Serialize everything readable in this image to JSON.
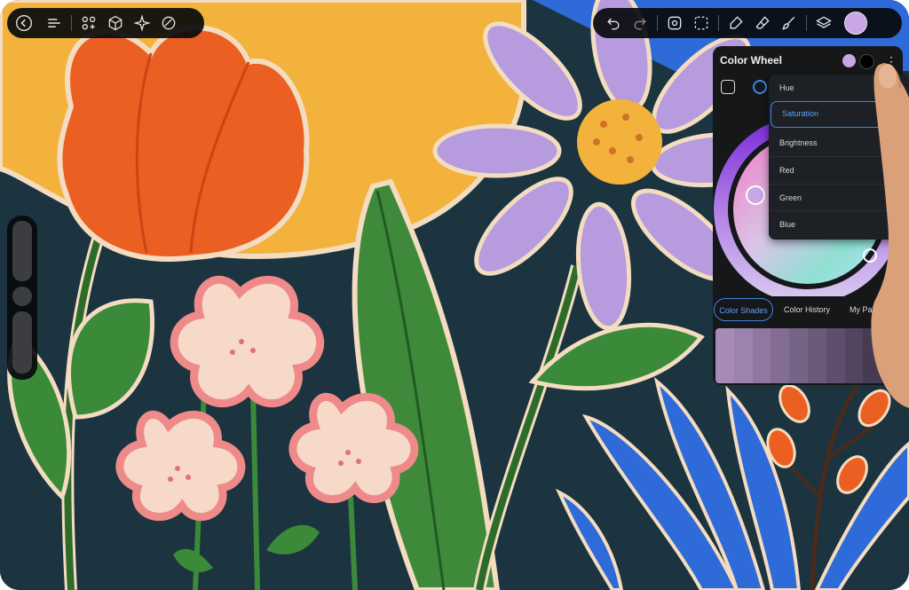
{
  "toolbar_left": {
    "back": "back-icon",
    "menu": "menu-icon",
    "actions": [
      "add-shape-icon",
      "cube-icon",
      "wand-icon",
      "eraser-shape-icon"
    ]
  },
  "toolbar_right": {
    "items": [
      "undo-icon",
      "redo-icon",
      "transform-icon",
      "selection-icon",
      "pen-icon",
      "eraser-icon",
      "brush-icon",
      "layers-icon"
    ],
    "current_color": "#c9a6e6"
  },
  "color_panel": {
    "title": "Color Wheel",
    "primary_color": "#c9a6e6",
    "secondary_color": "#000000",
    "mode_options": [
      "Hue",
      "Saturation",
      "Brightness",
      "Red",
      "Green",
      "Blue"
    ],
    "selected_mode": "Saturation",
    "tabs": [
      "Color Shades",
      "Color History",
      "My Pale"
    ],
    "active_tab": "Color Shades",
    "shades": [
      "#a68bb8",
      "#9c82ae",
      "#8f77a0",
      "#836d93",
      "#776386",
      "#6b5979",
      "#5f4f6c",
      "#53455f",
      "#473b52",
      "#3b3145"
    ]
  }
}
